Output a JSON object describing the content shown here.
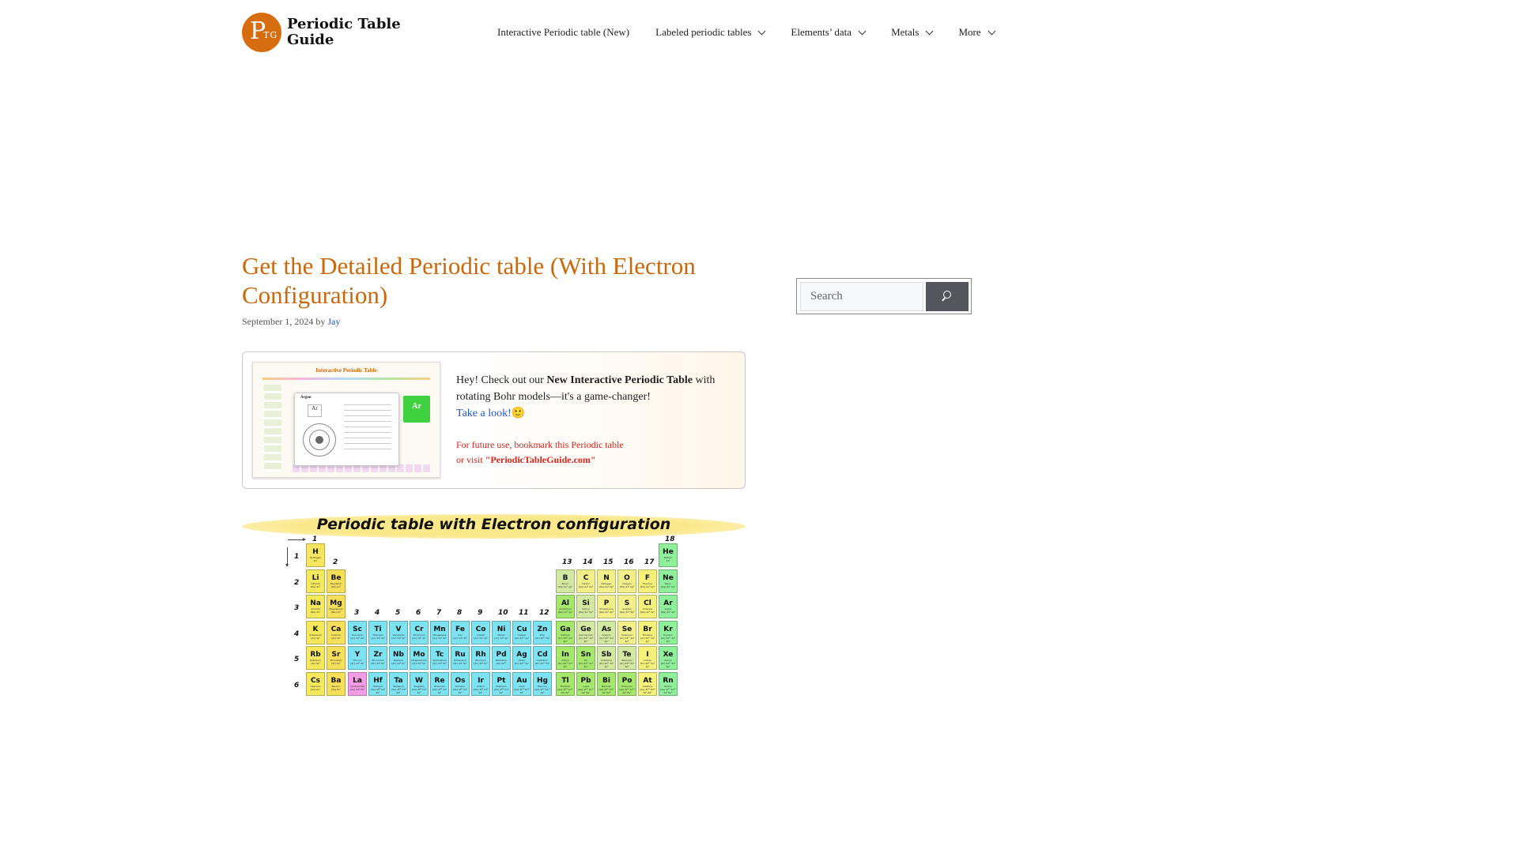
{
  "header": {
    "logo_mark_letter": "P",
    "logo_mark_sub": "TG",
    "logo_line1": "Periodic Table",
    "logo_line2": "Guide",
    "nav": [
      {
        "label": "Interactive Periodic table (New)",
        "dropdown": false
      },
      {
        "label": "Labeled periodic tables",
        "dropdown": true
      },
      {
        "label": "Elements’ data",
        "dropdown": true
      },
      {
        "label": "Metals",
        "dropdown": true
      },
      {
        "label": "More",
        "dropdown": true
      }
    ]
  },
  "article": {
    "title": "Get the Detailed Periodic table (With Electron Configuration)",
    "date": "September 1, 2024",
    "by": "by",
    "author": "Jay"
  },
  "promo": {
    "thumb_title": "Interactive Periodic Table",
    "thumb_element_name": "Argon",
    "thumb_symbol": "Ar",
    "text_before": "Hey! Check out our ",
    "text_bold": "New Interactive Periodic Table",
    "text_after": " with rotating Bohr models—it's a game-changer!",
    "link": "Take a look!",
    "emoji": "🙂",
    "note_line1": "For future use, bookmark this Periodic table",
    "note_line2_prefix": "or visit ",
    "note_site": "\"PeriodicTableGuide.com\""
  },
  "periodic_image": {
    "title": "Periodic table with Electron configuration",
    "groups": [
      "1",
      "2",
      "3",
      "4",
      "5",
      "6",
      "7",
      "8",
      "9",
      "10",
      "11",
      "12",
      "13",
      "14",
      "15",
      "16",
      "17",
      "18"
    ],
    "periods": [
      "1",
      "2",
      "3",
      "4",
      "5",
      "6"
    ],
    "colors": {
      "alkali": "#f4e85c",
      "alkaline": "#f6df5a",
      "transition": "#7ee3f0",
      "post": "#a6e86e",
      "metalloid": "#d3e8a0",
      "nonmetal": "#f1ef8a",
      "halogen": "#f4f07a",
      "noble": "#8fef9a",
      "lanthanide": "#f39ce6",
      "hydrogen": "#f6e55e"
    },
    "elements": [
      {
        "sym": "H",
        "name": "Hydrogen",
        "cfg": "1s¹",
        "g": 1,
        "p": 1,
        "c": "hydrogen"
      },
      {
        "sym": "He",
        "name": "Helium",
        "cfg": "1s²",
        "g": 18,
        "p": 1,
        "c": "noble"
      },
      {
        "sym": "Li",
        "name": "Lithium",
        "cfg": "[He] 2s¹",
        "g": 1,
        "p": 2,
        "c": "alkali"
      },
      {
        "sym": "Be",
        "name": "Beryllium",
        "cfg": "[He] 2s²",
        "g": 2,
        "p": 2,
        "c": "alkaline"
      },
      {
        "sym": "B",
        "name": "Boron",
        "cfg": "[He] 2s² 2p¹",
        "g": 13,
        "p": 2,
        "c": "metalloid"
      },
      {
        "sym": "C",
        "name": "Carbon",
        "cfg": "[He] 2s² 2p²",
        "g": 14,
        "p": 2,
        "c": "nonmetal"
      },
      {
        "sym": "N",
        "name": "Nitrogen",
        "cfg": "[He] 2s² 2p³",
        "g": 15,
        "p": 2,
        "c": "nonmetal"
      },
      {
        "sym": "O",
        "name": "Oxygen",
        "cfg": "[He] 2s² 2p⁴",
        "g": 16,
        "p": 2,
        "c": "nonmetal"
      },
      {
        "sym": "F",
        "name": "Fluorine",
        "cfg": "[He] 2s² 2p⁵",
        "g": 17,
        "p": 2,
        "c": "halogen"
      },
      {
        "sym": "Ne",
        "name": "Neon",
        "cfg": "[He] 2s² 2p⁶",
        "g": 18,
        "p": 2,
        "c": "noble"
      },
      {
        "sym": "Na",
        "name": "Sodium",
        "cfg": "[Ne] 3s¹",
        "g": 1,
        "p": 3,
        "c": "alkali"
      },
      {
        "sym": "Mg",
        "name": "Magnesium",
        "cfg": "[Ne] 3s²",
        "g": 2,
        "p": 3,
        "c": "alkaline"
      },
      {
        "sym": "Al",
        "name": "Aluminium",
        "cfg": "[Ne] 3s² 3p¹",
        "g": 13,
        "p": 3,
        "c": "post"
      },
      {
        "sym": "Si",
        "name": "Silicon",
        "cfg": "[Ne] 3s² 3p²",
        "g": 14,
        "p": 3,
        "c": "metalloid"
      },
      {
        "sym": "P",
        "name": "Phosphorus",
        "cfg": "[Ne] 3s² 3p³",
        "g": 15,
        "p": 3,
        "c": "nonmetal"
      },
      {
        "sym": "S",
        "name": "Sulphur",
        "cfg": "[Ne] 3s² 3p⁴",
        "g": 16,
        "p": 3,
        "c": "nonmetal"
      },
      {
        "sym": "Cl",
        "name": "Chlorine",
        "cfg": "[Ne] 3s² 3p⁵",
        "g": 17,
        "p": 3,
        "c": "halogen"
      },
      {
        "sym": "Ar",
        "name": "Argon",
        "cfg": "[Ne] 3s² 3p⁶",
        "g": 18,
        "p": 3,
        "c": "noble"
      },
      {
        "sym": "K",
        "name": "Potassium",
        "cfg": "[Ar] 4s¹",
        "g": 1,
        "p": 4,
        "c": "alkali"
      },
      {
        "sym": "Ca",
        "name": "Calcium",
        "cfg": "[Ar] 4s²",
        "g": 2,
        "p": 4,
        "c": "alkaline"
      },
      {
        "sym": "Sc",
        "name": "Scandium",
        "cfg": "[Ar] 3d¹ 4s²",
        "g": 3,
        "p": 4,
        "c": "transition"
      },
      {
        "sym": "Ti",
        "name": "Titanium",
        "cfg": "[Ar] 3d² 4s²",
        "g": 4,
        "p": 4,
        "c": "transition"
      },
      {
        "sym": "V",
        "name": "Vanadium",
        "cfg": "[Ar] 3d³ 4s²",
        "g": 5,
        "p": 4,
        "c": "transition"
      },
      {
        "sym": "Cr",
        "name": "Chromium",
        "cfg": "[Ar] 3d⁵ 4s¹",
        "g": 6,
        "p": 4,
        "c": "transition"
      },
      {
        "sym": "Mn",
        "name": "Manganese",
        "cfg": "[Ar] 3d⁵ 4s²",
        "g": 7,
        "p": 4,
        "c": "transition"
      },
      {
        "sym": "Fe",
        "name": "Iron",
        "cfg": "[Ar] 3d⁶ 4s²",
        "g": 8,
        "p": 4,
        "c": "transition"
      },
      {
        "sym": "Co",
        "name": "Cobalt",
        "cfg": "[Ar] 3d⁷ 4s²",
        "g": 9,
        "p": 4,
        "c": "transition"
      },
      {
        "sym": "Ni",
        "name": "Nickel",
        "cfg": "[Ar] 3d⁸ 4s²",
        "g": 10,
        "p": 4,
        "c": "transition"
      },
      {
        "sym": "Cu",
        "name": "Copper",
        "cfg": "[Ar] 3d¹⁰ 4s¹",
        "g": 11,
        "p": 4,
        "c": "transition"
      },
      {
        "sym": "Zn",
        "name": "Zinc",
        "cfg": "[Ar] 3d¹⁰ 4s²",
        "g": 12,
        "p": 4,
        "c": "transition"
      },
      {
        "sym": "Ga",
        "name": "Gallium",
        "cfg": "[Ar] 3d¹⁰ 4s² 4p¹",
        "g": 13,
        "p": 4,
        "c": "post"
      },
      {
        "sym": "Ge",
        "name": "Germanium",
        "cfg": "[Ar] 3d¹⁰ 4s² 4p²",
        "g": 14,
        "p": 4,
        "c": "metalloid"
      },
      {
        "sym": "As",
        "name": "Arsenic",
        "cfg": "[Ar] 3d¹⁰ 4s² 4p³",
        "g": 15,
        "p": 4,
        "c": "metalloid"
      },
      {
        "sym": "Se",
        "name": "Selenium",
        "cfg": "[Ar] 3d¹⁰ 4s² 4p⁴",
        "g": 16,
        "p": 4,
        "c": "nonmetal"
      },
      {
        "sym": "Br",
        "name": "Bromine",
        "cfg": "[Ar] 3d¹⁰ 4s² 4p⁵",
        "g": 17,
        "p": 4,
        "c": "halogen"
      },
      {
        "sym": "Kr",
        "name": "Krypton",
        "cfg": "[Ar] 3d¹⁰ 4s² 4p⁶",
        "g": 18,
        "p": 4,
        "c": "noble"
      },
      {
        "sym": "Rb",
        "name": "Rubidium",
        "cfg": "[Kr] 5s¹",
        "g": 1,
        "p": 5,
        "c": "alkali"
      },
      {
        "sym": "Sr",
        "name": "Strontium",
        "cfg": "[Kr] 5s²",
        "g": 2,
        "p": 5,
        "c": "alkaline"
      },
      {
        "sym": "Y",
        "name": "Yttrium",
        "cfg": "[Kr] 4d¹ 5s²",
        "g": 3,
        "p": 5,
        "c": "transition"
      },
      {
        "sym": "Zr",
        "name": "Zirconium",
        "cfg": "[Kr] 4d² 5s²",
        "g": 4,
        "p": 5,
        "c": "transition"
      },
      {
        "sym": "Nb",
        "name": "Niobium",
        "cfg": "[Kr] 4d⁴ 5s¹",
        "g": 5,
        "p": 5,
        "c": "transition"
      },
      {
        "sym": "Mo",
        "name": "Molybdenum",
        "cfg": "[Kr] 4d⁵ 5s¹",
        "g": 6,
        "p": 5,
        "c": "transition"
      },
      {
        "sym": "Tc",
        "name": "Technetium",
        "cfg": "[Kr] 4d⁵ 5s²",
        "g": 7,
        "p": 5,
        "c": "transition"
      },
      {
        "sym": "Ru",
        "name": "Ruthenium",
        "cfg": "[Kr] 4d⁷ 5s¹",
        "g": 8,
        "p": 5,
        "c": "transition"
      },
      {
        "sym": "Rh",
        "name": "Rhodium",
        "cfg": "[Kr] 4d⁸ 5s¹",
        "g": 9,
        "p": 5,
        "c": "transition"
      },
      {
        "sym": "Pd",
        "name": "Palladium",
        "cfg": "[Kr] 4d¹⁰",
        "g": 10,
        "p": 5,
        "c": "transition"
      },
      {
        "sym": "Ag",
        "name": "Silver",
        "cfg": "[Kr] 4d¹⁰ 5s¹",
        "g": 11,
        "p": 5,
        "c": "transition"
      },
      {
        "sym": "Cd",
        "name": "Cadmium",
        "cfg": "[Kr] 4d¹⁰ 5s²",
        "g": 12,
        "p": 5,
        "c": "transition"
      },
      {
        "sym": "In",
        "name": "Indium",
        "cfg": "[Kr] 4d¹⁰ 5s² 5p¹",
        "g": 13,
        "p": 5,
        "c": "post"
      },
      {
        "sym": "Sn",
        "name": "Tin",
        "cfg": "[Kr] 4d¹⁰ 5s² 5p²",
        "g": 14,
        "p": 5,
        "c": "post"
      },
      {
        "sym": "Sb",
        "name": "Antimony",
        "cfg": "[Kr] 4d¹⁰ 5s² 5p³",
        "g": 15,
        "p": 5,
        "c": "metalloid"
      },
      {
        "sym": "Te",
        "name": "Tellurium",
        "cfg": "[Kr] 4d¹⁰ 5s² 5p⁴",
        "g": 16,
        "p": 5,
        "c": "metalloid"
      },
      {
        "sym": "I",
        "name": "Iodine",
        "cfg": "[Kr] 4d¹⁰ 5s² 5p⁵",
        "g": 17,
        "p": 5,
        "c": "halogen"
      },
      {
        "sym": "Xe",
        "name": "Xenon",
        "cfg": "[Kr] 4d¹⁰ 5s² 5p⁶",
        "g": 18,
        "p": 5,
        "c": "noble"
      },
      {
        "sym": "Cs",
        "name": "Caesium",
        "cfg": "[Xe] 6s¹",
        "g": 1,
        "p": 6,
        "c": "alkali"
      },
      {
        "sym": "Ba",
        "name": "Barium",
        "cfg": "[Xe] 6s²",
        "g": 2,
        "p": 6,
        "c": "alkaline"
      },
      {
        "sym": "La",
        "name": "Lanthanides",
        "cfg": "[Xe] 5d¹ 6s²",
        "g": 3,
        "p": 6,
        "c": "lanthanide"
      },
      {
        "sym": "Hf",
        "name": "Hafnium",
        "cfg": "[Xe] 4f¹⁴ 5d² 6s²",
        "g": 4,
        "p": 6,
        "c": "transition"
      },
      {
        "sym": "Ta",
        "name": "Tantalum",
        "cfg": "[Xe] 4f¹⁴ 5d³ 6s²",
        "g": 5,
        "p": 6,
        "c": "transition"
      },
      {
        "sym": "W",
        "name": "Tungsten",
        "cfg": "[Xe] 4f¹⁴ 5d⁴ 6s²",
        "g": 6,
        "p": 6,
        "c": "transition"
      },
      {
        "sym": "Re",
        "name": "Rhenium",
        "cfg": "[Xe] 4f¹⁴ 5d⁵ 6s²",
        "g": 7,
        "p": 6,
        "c": "transition"
      },
      {
        "sym": "Os",
        "name": "Osmium",
        "cfg": "[Xe] 4f¹⁴ 5d⁶ 6s²",
        "g": 8,
        "p": 6,
        "c": "transition"
      },
      {
        "sym": "Ir",
        "name": "Iridium",
        "cfg": "[Xe] 4f¹⁴ 5d⁷ 6s²",
        "g": 9,
        "p": 6,
        "c": "transition"
      },
      {
        "sym": "Pt",
        "name": "Platinum",
        "cfg": "[Xe] 4f¹⁴ 5d⁹ 6s¹",
        "g": 10,
        "p": 6,
        "c": "transition"
      },
      {
        "sym": "Au",
        "name": "Gold",
        "cfg": "[Xe] 4f¹⁴ 5d¹⁰ 6s¹",
        "g": 11,
        "p": 6,
        "c": "transition"
      },
      {
        "sym": "Hg",
        "name": "Mercury",
        "cfg": "[Xe] 4f¹⁴ 5d¹⁰ 6s²",
        "g": 12,
        "p": 6,
        "c": "transition"
      },
      {
        "sym": "Tl",
        "name": "Thallium",
        "cfg": "[Xe] 4f¹⁴ 5d¹⁰ 6s² 6p¹",
        "g": 13,
        "p": 6,
        "c": "post"
      },
      {
        "sym": "Pb",
        "name": "Lead",
        "cfg": "[Xe] 4f¹⁴ 5d¹⁰ 6s² 6p²",
        "g": 14,
        "p": 6,
        "c": "post"
      },
      {
        "sym": "Bi",
        "name": "Bismuth",
        "cfg": "[Xe] 4f¹⁴ 5d¹⁰ 6s² 6p³",
        "g": 15,
        "p": 6,
        "c": "post"
      },
      {
        "sym": "Po",
        "name": "Polonium",
        "cfg": "[Xe] 4f¹⁴ 5d¹⁰ 6s² 6p⁴",
        "g": 16,
        "p": 6,
        "c": "post"
      },
      {
        "sym": "At",
        "name": "Astatine",
        "cfg": "[Xe] 4f¹⁴ 5d¹⁰ 6s² 6p⁵",
        "g": 17,
        "p": 6,
        "c": "halogen"
      },
      {
        "sym": "Rn",
        "name": "Radon",
        "cfg": "[Xe] 4f¹⁴ 5d¹⁰ 6s² 6p⁶",
        "g": 18,
        "p": 6,
        "c": "noble"
      }
    ]
  },
  "sidebar": {
    "search_placeholder": "Search",
    "search_icon": "search-icon",
    "search_button_color": "#55555e"
  },
  "colors": {
    "accent": "#c9680c",
    "link": "#1e55c7",
    "note": "#d8261b"
  }
}
